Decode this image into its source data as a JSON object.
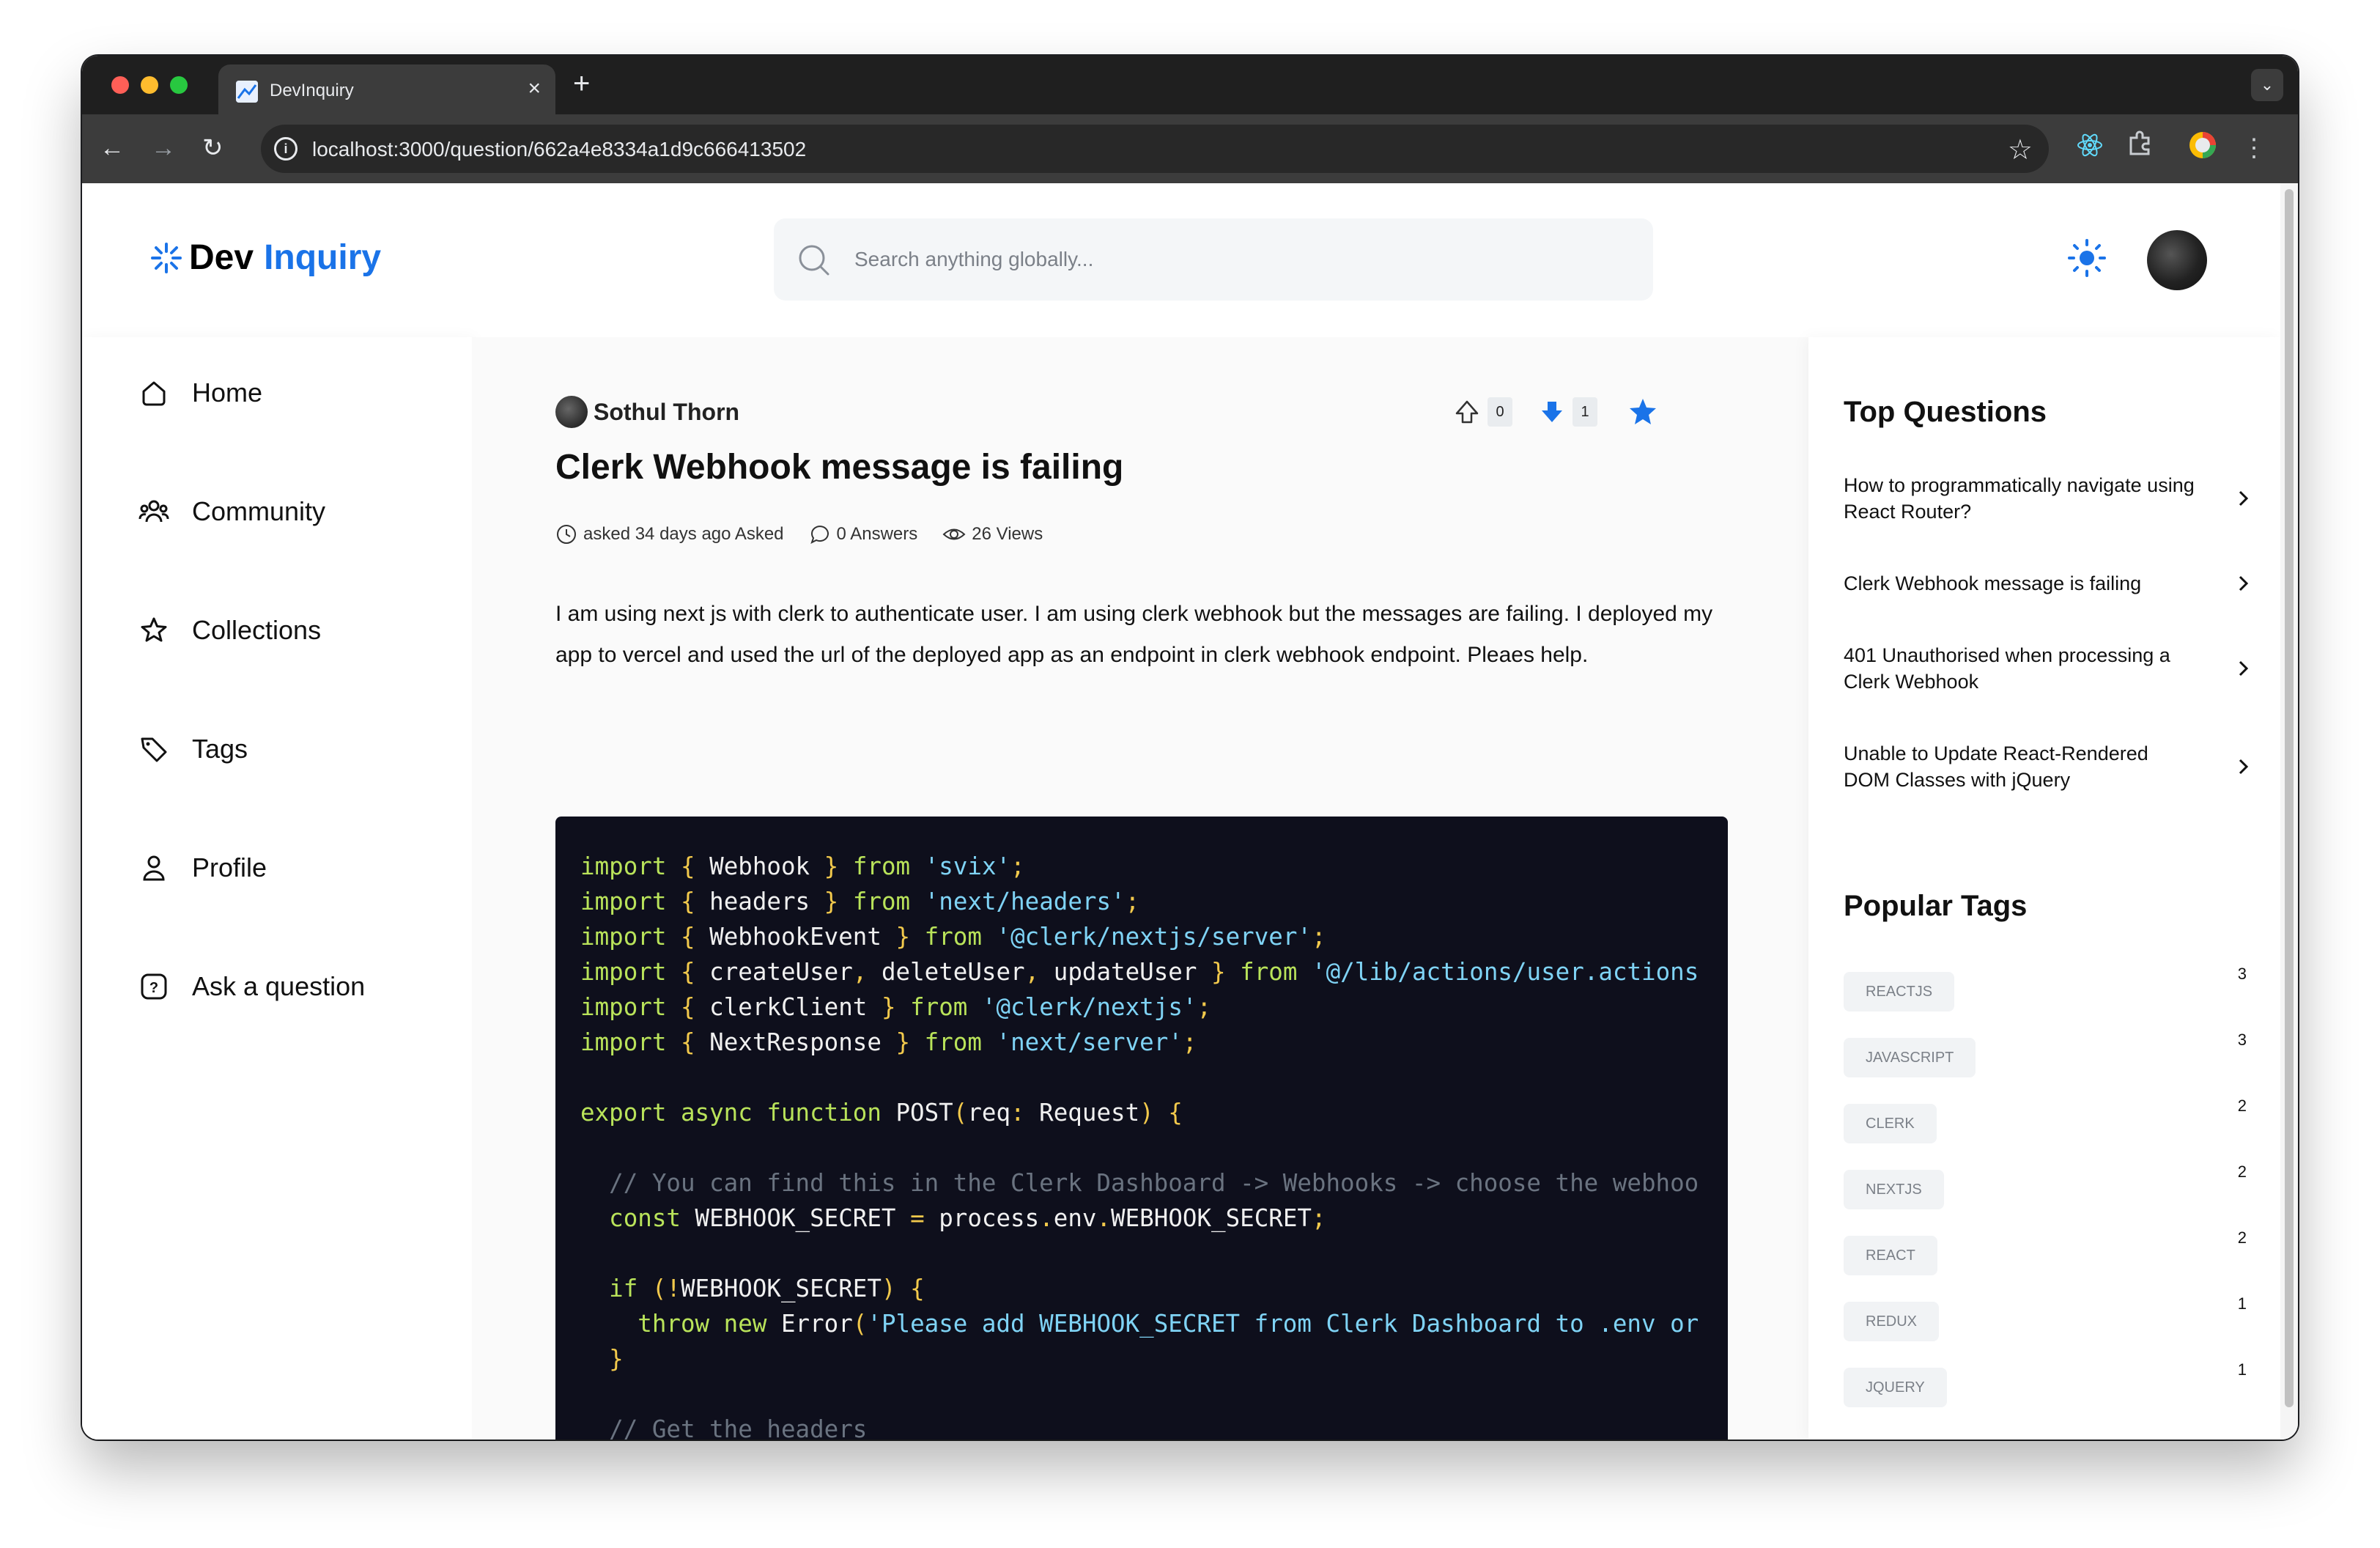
{
  "browser": {
    "tab_title": "DevInquiry",
    "url": "localhost:3000/question/662a4e8334a1d9c666413502"
  },
  "header": {
    "logo_part1": "Dev",
    "logo_part2": "Inquiry",
    "search_placeholder": "Search anything globally..."
  },
  "sidebar": {
    "items": [
      {
        "label": "Home"
      },
      {
        "label": "Community"
      },
      {
        "label": "Collections"
      },
      {
        "label": "Tags"
      },
      {
        "label": "Profile"
      },
      {
        "label": "Ask a question"
      }
    ]
  },
  "question": {
    "author": "Sothul Thorn",
    "title": "Clerk Webhook message is failing",
    "upvotes": "0",
    "downvotes": "1",
    "asked": "asked 34 days ago Asked",
    "answers": "0 Answers",
    "views": "26 Views",
    "body": "I am using next js with clerk to authenticate user. I am using clerk webhook but the messages are failing. I deployed my app to vercel and used the url of the deployed app as an endpoint in clerk webhook endpoint. Pleaes help."
  },
  "right": {
    "top_questions_title": "Top Questions",
    "top_questions": [
      "How to programmatically navigate using React Router?",
      "Clerk Webhook message is failing",
      "401 Unauthorised when processing a Clerk Webhook",
      "Unable to Update React-Rendered DOM Classes with jQuery"
    ],
    "popular_tags_title": "Popular Tags",
    "tags": [
      {
        "name": "REACTJS",
        "count": "3"
      },
      {
        "name": "JAVASCRIPT",
        "count": "3"
      },
      {
        "name": "CLERK",
        "count": "2"
      },
      {
        "name": "NEXTJS",
        "count": "2"
      },
      {
        "name": "REACT",
        "count": "2"
      },
      {
        "name": "REDUX",
        "count": "1"
      },
      {
        "name": "JQUERY",
        "count": "1"
      }
    ]
  },
  "colors": {
    "accent": "#1a73e8",
    "code_bg": "#0e0f1c",
    "keyword": "#b9e35a",
    "string": "#7fd3f5"
  }
}
